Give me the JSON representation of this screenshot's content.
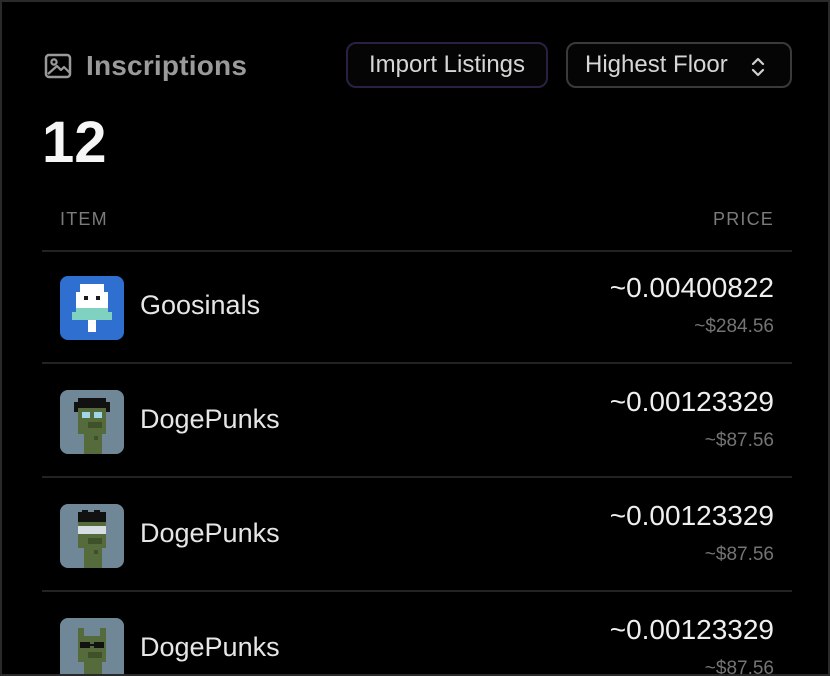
{
  "header": {
    "title": "Inscriptions",
    "title_icon": "image-icon",
    "import_label": "Import Listings",
    "sort_label": "Highest Floor",
    "sort_icon": "chevron-up-down-icon"
  },
  "summary": {
    "count": "12"
  },
  "table": {
    "columns": {
      "item": "ITEM",
      "price": "PRICE"
    },
    "rows": [
      {
        "name": "Goosinals",
        "price": "~0.00400822",
        "usd": "~$284.56",
        "thumb": "goose-avatar"
      },
      {
        "name": "DogePunks",
        "price": "~0.00123329",
        "usd": "~$87.56",
        "thumb": "doge-punk-headphones"
      },
      {
        "name": "DogePunks",
        "price": "~0.00123329",
        "usd": "~$87.56",
        "thumb": "doge-punk-visor"
      },
      {
        "name": "DogePunks",
        "price": "~0.00123329",
        "usd": "~$87.56",
        "thumb": "doge-punk-shades"
      }
    ]
  },
  "colors": {
    "background": "#000000",
    "text_primary": "#e8e8e8",
    "text_muted": "#7b7b7b",
    "divider": "#232323",
    "import_border": "#2a2140",
    "goose_bg": "#2f6fd0",
    "punk_bg": "#6f8797",
    "punk_skin": "#556b3b"
  }
}
